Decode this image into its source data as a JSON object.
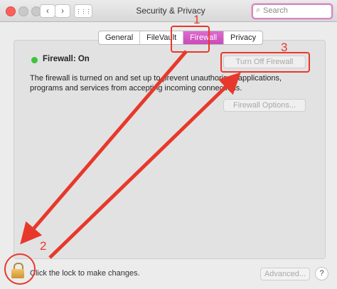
{
  "window": {
    "title": "Security & Privacy",
    "nav_back_icon": "‹",
    "nav_forward_icon": "›",
    "grid_icon": "⋮⋮⋮",
    "search_placeholder": "Search",
    "search_icon": "⌕"
  },
  "tabs": [
    {
      "label": "General",
      "active": false
    },
    {
      "label": "FileVault",
      "active": false
    },
    {
      "label": "Firewall",
      "active": true
    },
    {
      "label": "Privacy",
      "active": false
    }
  ],
  "firewall": {
    "status": "Firewall: On",
    "turn_off_label": "Turn Off Firewall",
    "description": "The firewall is turned on and set up to prevent unauthorised applications, programs and services from accepting incoming connections.",
    "options_label": "Firewall Options..."
  },
  "footer": {
    "lock_text": "Click the lock to make changes.",
    "advanced_label": "Advanced...",
    "help_label": "?"
  },
  "annotations": {
    "num1": "1",
    "num2": "2",
    "num3": "3"
  },
  "colors": {
    "accent": "#d354c4",
    "annotation_red": "#e8382b",
    "status_green": "#3cc43c"
  }
}
